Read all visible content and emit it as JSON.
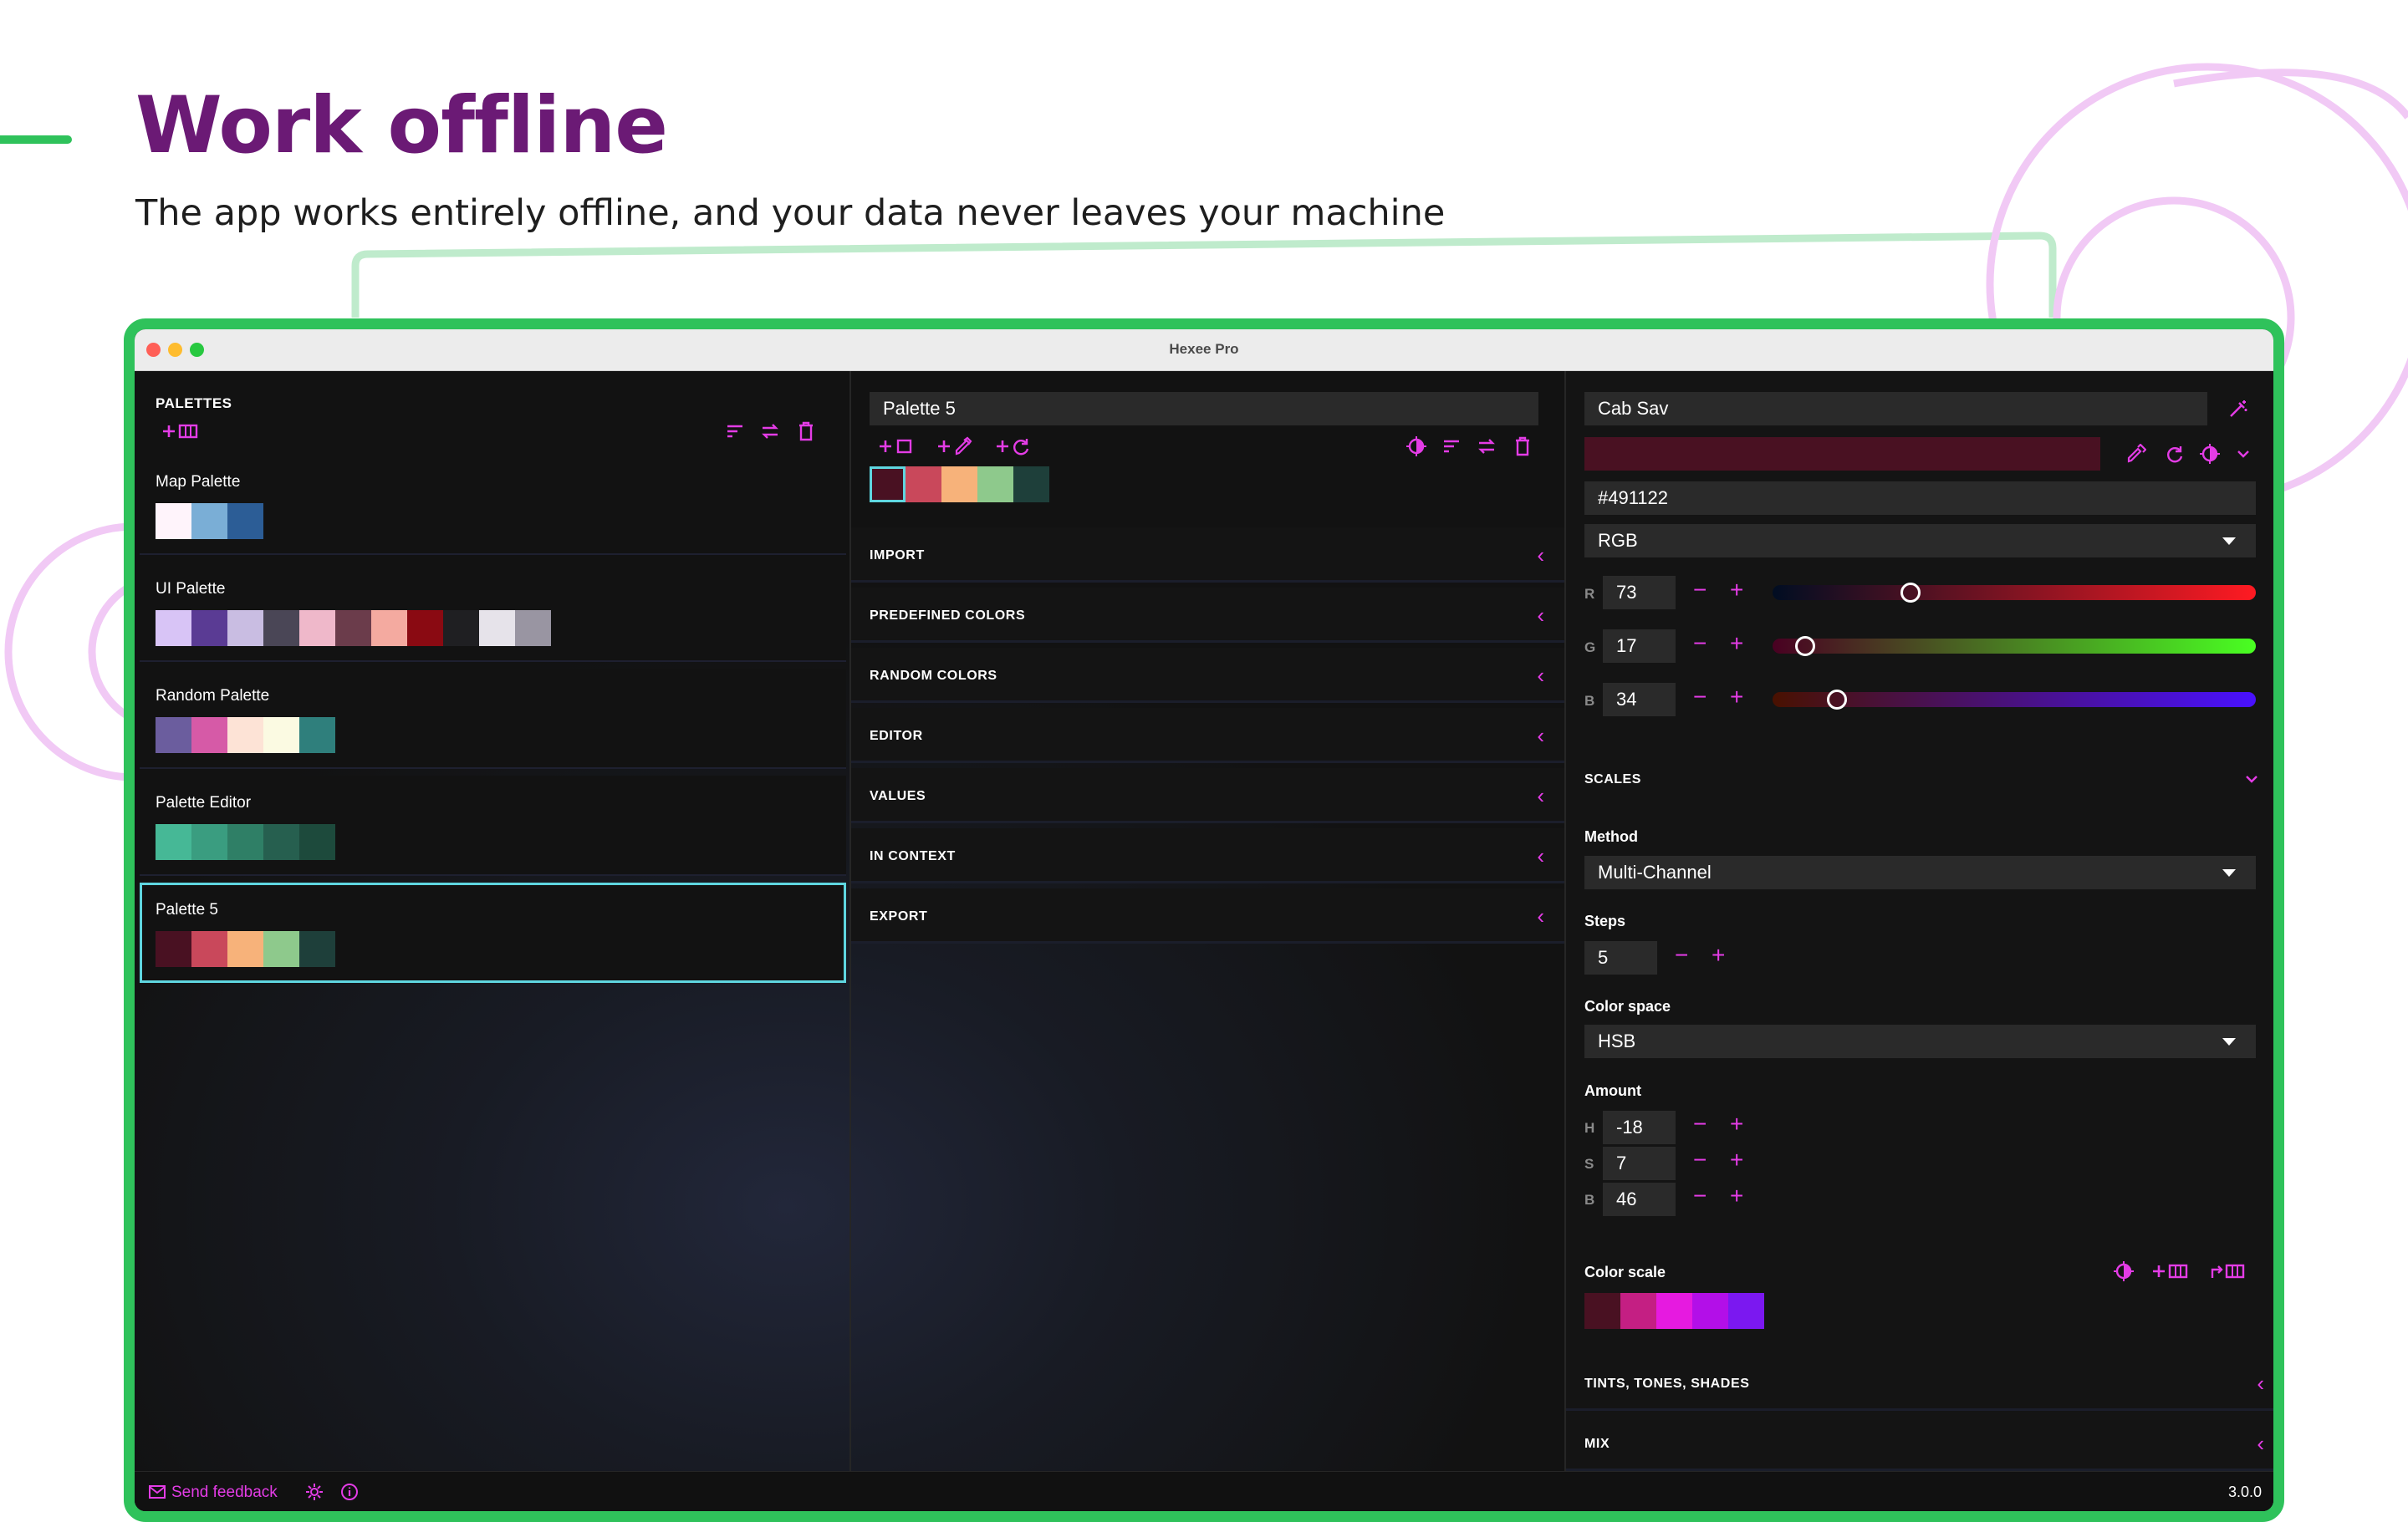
{
  "page": {
    "headline": "Work offline",
    "subline": "The app works entirely offline, and your data never leaves your machine"
  },
  "window": {
    "title": "Hexee Pro"
  },
  "palettes": {
    "title": "PALETTES",
    "items": [
      {
        "name": "Map Palette",
        "colors": [
          "#fff4fb",
          "#7aaed6",
          "#2c5d96"
        ]
      },
      {
        "name": "UI Palette",
        "colors": [
          "#d8c4f6",
          "#5a3b94",
          "#c9bde2",
          "#4a4656",
          "#efb8ca",
          "#6b3c4b",
          "#f4aaa0",
          "#8a0a12",
          "#1f1f22",
          "#e6e3ea",
          "#9995a2"
        ]
      },
      {
        "name": "Random Palette",
        "colors": [
          "#6b5d9e",
          "#d65aa7",
          "#fde3d6",
          "#fbfae2",
          "#2f7f7c"
        ]
      },
      {
        "name": "Palette Editor",
        "colors": [
          "#46b896",
          "#3a9d80",
          "#2f7f66",
          "#265f4f",
          "#1d4a3c"
        ]
      },
      {
        "name": "Palette 5",
        "colors": [
          "#491122",
          "#c9485b",
          "#f7b27a",
          "#8ec98c",
          "#1e3f3a"
        ]
      }
    ]
  },
  "editor": {
    "palette_name": "Palette 5",
    "swatches": [
      "#491122",
      "#c9485b",
      "#f7b27a",
      "#8ec98c",
      "#1e3f3a"
    ],
    "sections": [
      "IMPORT",
      "PREDEFINED COLORS",
      "RANDOM COLORS",
      "EDITOR",
      "VALUES",
      "IN CONTEXT",
      "EXPORT"
    ]
  },
  "color": {
    "name": "Cab Sav",
    "hex": "#491122",
    "mode": "RGB",
    "channels": [
      {
        "letter": "R",
        "value": "73"
      },
      {
        "letter": "G",
        "value": "17"
      },
      {
        "letter": "B",
        "value": "34"
      }
    ],
    "channel_fraction": [
      0.286,
      0.067,
      0.133
    ],
    "swatch_color": "#491122"
  },
  "scales": {
    "title": "SCALES",
    "method_label": "Method",
    "method_value": "Multi-Channel",
    "steps_label": "Steps",
    "steps_value": "5",
    "space_label": "Color space",
    "space_value": "HSB",
    "amount_label": "Amount",
    "amount": [
      {
        "letter": "H",
        "value": "-18"
      },
      {
        "letter": "S",
        "value": "7"
      },
      {
        "letter": "B",
        "value": "46"
      }
    ],
    "scale_label": "Color scale",
    "scale_colors": [
      "#491122",
      "#c41f83",
      "#e61ae0",
      "#b30fe8",
      "#7b18f0"
    ]
  },
  "bottom_sections": [
    "TINTS, TONES, SHADES",
    "MIX"
  ],
  "footer": {
    "feedback": "Send feedback",
    "version": "3.0.0"
  },
  "colors": {
    "accent": "#e43ce6",
    "frame": "#2fc25b",
    "headline": "#6b1a75",
    "active_border": "#5fd6e0"
  }
}
